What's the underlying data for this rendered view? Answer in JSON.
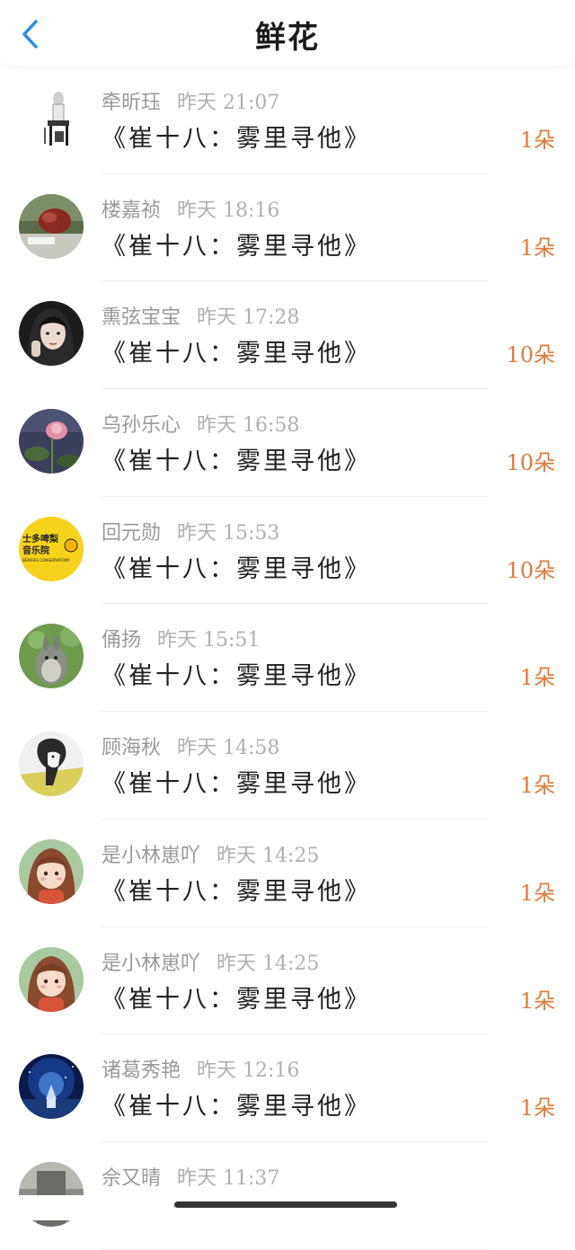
{
  "header": {
    "title": "鲜花",
    "back_icon": "chevron-left-icon",
    "accent_color": "#2f8fe8"
  },
  "list": [
    {
      "name": "牵昕珏",
      "time": "昨天 21:07",
      "book": "《崔十八：雾里寻他》",
      "count": "1朵",
      "avatar": "chair-figure"
    },
    {
      "name": "楼嘉祯",
      "time": "昨天 18:16",
      "book": "《崔十八：雾里寻他》",
      "count": "1朵",
      "avatar": "sculpture"
    },
    {
      "name": "熏弦宝宝",
      "time": "昨天 17:28",
      "book": "《崔十八：雾里寻他》",
      "count": "10朵",
      "avatar": "girl-portrait"
    },
    {
      "name": "乌孙乐心",
      "time": "昨天 16:58",
      "book": "《崔十八：雾里寻他》",
      "count": "10朵",
      "avatar": "lotus"
    },
    {
      "name": "回元勋",
      "time": "昨天 15:53",
      "book": "《崔十八：雾里寻他》",
      "count": "10朵",
      "avatar": "logo-yellow",
      "avatar_text": [
        "士多啤梨",
        "音乐院",
        "BERRIES CONSERVATORY"
      ]
    },
    {
      "name": "俑扬",
      "time": "昨天 15:51",
      "book": "《崔十八：雾里寻他》",
      "count": "1朵",
      "avatar": "totoro"
    },
    {
      "name": "顾海秋",
      "time": "昨天 14:58",
      "book": "《崔十八：雾里寻他》",
      "count": "1朵",
      "avatar": "sketch-face"
    },
    {
      "name": "是小林崽吖",
      "time": "昨天 14:25",
      "book": "《崔十八：雾里寻他》",
      "count": "1朵",
      "avatar": "cartoon-girl"
    },
    {
      "name": "是小林崽吖",
      "time": "昨天 14:25",
      "book": "《崔十八：雾里寻他》",
      "count": "1朵",
      "avatar": "cartoon-girl"
    },
    {
      "name": "诸葛秀艳",
      "time": "昨天 12:16",
      "book": "《崔十八：雾里寻他》",
      "count": "1朵",
      "avatar": "night-church"
    },
    {
      "name": "佘又晴",
      "time": "昨天 11:37",
      "book": "",
      "count": "",
      "avatar": "gray-photo"
    }
  ]
}
